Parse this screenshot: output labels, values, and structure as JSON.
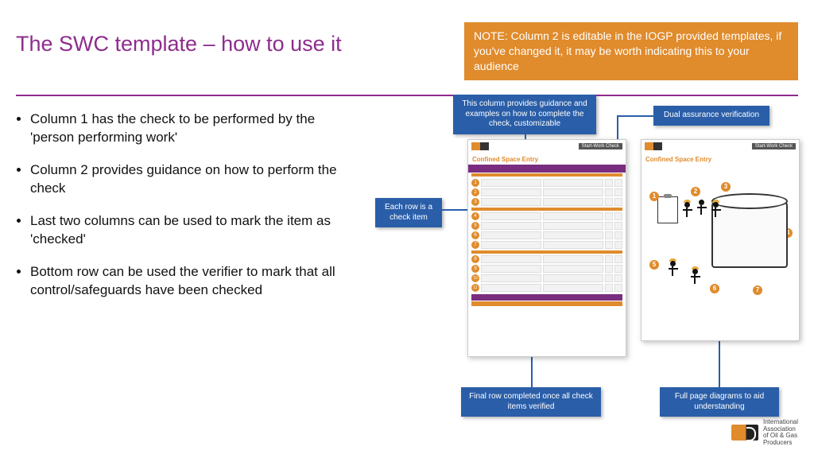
{
  "title": "The SWC template – how to use it",
  "note": "NOTE: Column 2 is editable in the IOGP provided templates, if you've changed it, it may be worth indicating this to your audience",
  "bullets": [
    "Column 1 has the check to be performed by the 'person performing work'",
    "Column 2 provides guidance on how to perform the check",
    "Last two columns can be used to mark the item as 'checked'",
    "Bottom row can be used the verifier to mark that all control/safeguards have been  checked"
  ],
  "callouts": {
    "guidance": "This column provides guidance and examples on how to complete the check, customizable",
    "dual": "Dual assurance verification",
    "row": "Each row is a check item",
    "final": "Final row completed once all check items verified",
    "diagrams": "Full page diagrams to aid understanding"
  },
  "card": {
    "tag": "Start-Work Check",
    "title": "Confined Space Entry"
  },
  "footer": {
    "org": "International\nAssociation\nof Oil & Gas\nProducers"
  }
}
